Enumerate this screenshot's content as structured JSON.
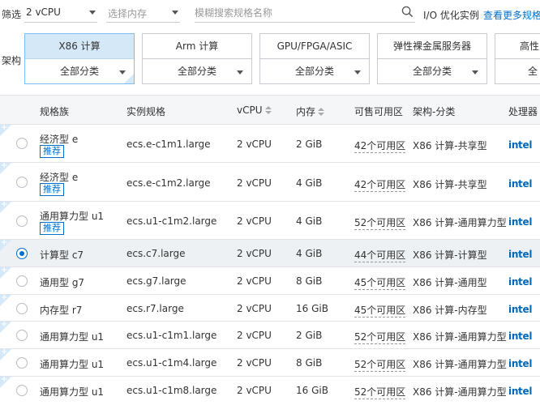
{
  "filter": {
    "label": "筛选",
    "vcpu_value": "2 vCPU",
    "memory_placeholder": "选择内存",
    "search_placeholder": "模糊搜索规格名称",
    "io_label": "I/O 优化实例",
    "more_link": "查看更多规格"
  },
  "arch": {
    "label": "架构",
    "cards": [
      {
        "title": "X86 计算",
        "sub": "全部分类"
      },
      {
        "title": "Arm 计算",
        "sub": "全部分类"
      },
      {
        "title": "GPU/FPGA/ASIC",
        "sub": "全部分类"
      },
      {
        "title": "弹性裸金属服务器",
        "sub": "全部分类"
      },
      {
        "title": "高性",
        "sub": "全"
      }
    ]
  },
  "table": {
    "headers": {
      "family": "规格族",
      "spec": "实例规格",
      "vcpu": "vCPU",
      "memory": "内存",
      "zones": "可售可用区",
      "arch": "架构-分类",
      "cpu": "处理器"
    },
    "recommend_badge": "推荐",
    "processor_logo": "intel",
    "rows": [
      {
        "family": "经济型 e",
        "spec": "ecs.e-c1m1.large",
        "vcpu": "2 vCPU",
        "memory": "2 GiB",
        "zones": "42个可用区",
        "arch": "X86 计算-共享型"
      },
      {
        "family": "经济型 e",
        "spec": "ecs.e-c1m2.large",
        "vcpu": "2 vCPU",
        "memory": "4 GiB",
        "zones": "42个可用区",
        "arch": "X86 计算-共享型"
      },
      {
        "family": "通用算力型 u1",
        "spec": "ecs.u1-c1m2.large",
        "vcpu": "2 vCPU",
        "memory": "4 GiB",
        "zones": "52个可用区",
        "arch": "X86 计算-通用算力型"
      },
      {
        "family": "计算型 c7",
        "spec": "ecs.c7.large",
        "vcpu": "2 vCPU",
        "memory": "4 GiB",
        "zones": "44个可用区",
        "arch": "X86 计算-计算型"
      },
      {
        "family": "通用型 g7",
        "spec": "ecs.g7.large",
        "vcpu": "2 vCPU",
        "memory": "8 GiB",
        "zones": "45个可用区",
        "arch": "X86 计算-通用型"
      },
      {
        "family": "内存型 r7",
        "spec": "ecs.r7.large",
        "vcpu": "2 vCPU",
        "memory": "16 GiB",
        "zones": "45个可用区",
        "arch": "X86 计算-内存型"
      },
      {
        "family": "通用算力型 u1",
        "spec": "ecs.u1-c1m1.large",
        "vcpu": "2 vCPU",
        "memory": "2 GiB",
        "zones": "52个可用区",
        "arch": "X86 计算-通用算力型"
      },
      {
        "family": "通用算力型 u1",
        "spec": "ecs.u1-c1m4.large",
        "vcpu": "2 vCPU",
        "memory": "8 GiB",
        "zones": "52个可用区",
        "arch": "X86 计算-通用算力型"
      },
      {
        "family": "通用算力型 u1",
        "spec": "ecs.u1-c1m8.large",
        "vcpu": "2 vCPU",
        "memory": "16 GiB",
        "zones": "52个可用区",
        "arch": "X86 计算-通用算力型"
      }
    ]
  },
  "colors": {
    "accent": "#0070cc",
    "selected_row": "#eef1f4",
    "active_card": "#d4e8f8"
  }
}
